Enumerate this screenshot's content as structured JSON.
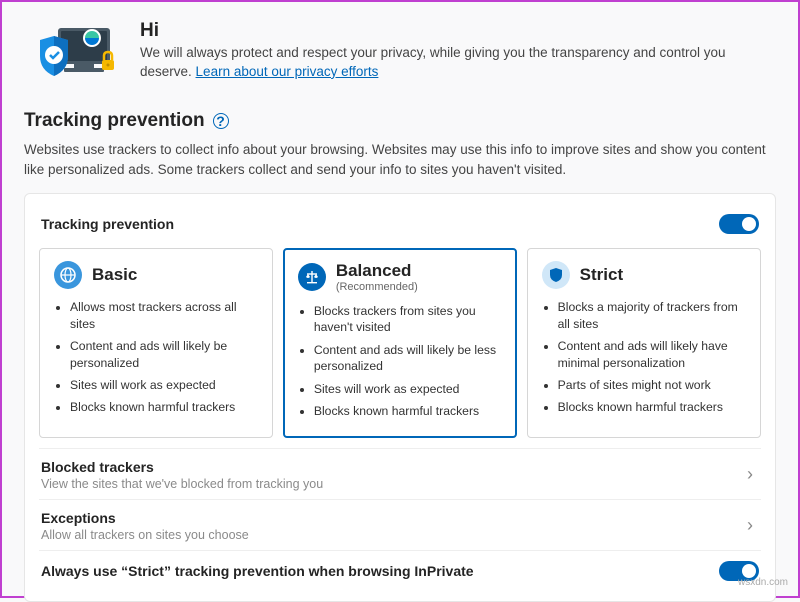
{
  "hero": {
    "greeting": "Hi",
    "body": "We will always protect and respect your privacy, while giving you the transparency and control you deserve.",
    "link": "Learn about our privacy efforts"
  },
  "section": {
    "title": "Tracking prevention",
    "desc": "Websites use trackers to collect info about your browsing. Websites may use this info to improve sites and show you content like personalized ads. Some trackers collect and send your info to sites you haven't visited."
  },
  "toggle_row": {
    "label": "Tracking prevention"
  },
  "cards": {
    "basic": {
      "title": "Basic",
      "bullets": [
        "Allows most trackers across all sites",
        "Content and ads will likely be personalized",
        "Sites will work as expected",
        "Blocks known harmful trackers"
      ]
    },
    "balanced": {
      "title": "Balanced",
      "sub": "(Recommended)",
      "bullets": [
        "Blocks trackers from sites you haven't visited",
        "Content and ads will likely be less personalized",
        "Sites will work as expected",
        "Blocks known harmful trackers"
      ]
    },
    "strict": {
      "title": "Strict",
      "bullets": [
        "Blocks a majority of trackers from all sites",
        "Content and ads will likely have minimal personalization",
        "Parts of sites might not work",
        "Blocks known harmful trackers"
      ]
    }
  },
  "links": {
    "blocked": {
      "title": "Blocked trackers",
      "desc": "View the sites that we've blocked from tracking you"
    },
    "exceptions": {
      "title": "Exceptions",
      "desc": "Allow all trackers on sites you choose"
    },
    "inprivate": {
      "title": "Always use “Strict” tracking prevention when browsing InPrivate"
    }
  },
  "watermark": "wsxdn.com"
}
